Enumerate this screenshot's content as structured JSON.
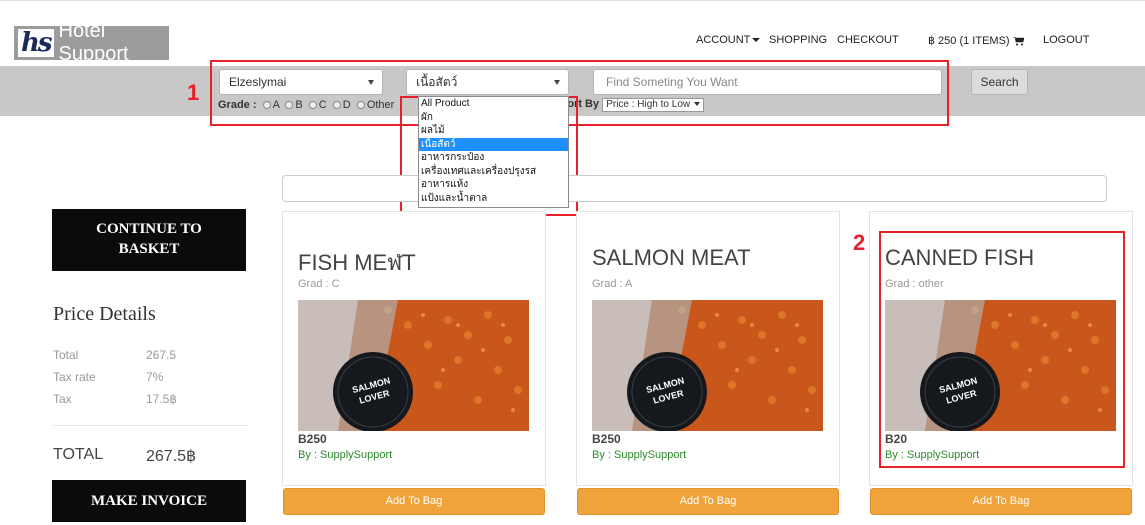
{
  "brand": {
    "mark": "hs",
    "name": "Hotel Support"
  },
  "nav": {
    "account": "ACCOUNT",
    "shopping": "SHOPPING",
    "checkout": "CHECKOUT",
    "cart": "฿ 250 (1 ITEMS)",
    "logout": "LOGOUT"
  },
  "filters": {
    "location": "Elzeslymai",
    "category": "เนื้อสัตว์",
    "search_placeholder": "Find Someting You Want",
    "search_button": "Search",
    "grade_label": "Grade :",
    "grades": [
      "A",
      "B",
      "C",
      "D",
      "Other"
    ],
    "sort_label": "Sort By",
    "sort_value": "Price : High to Low"
  },
  "category_options": [
    "All Product",
    "ผัก",
    "ผลไม้",
    "เนื้อสัตว์",
    "อาหารกระป๋อง",
    "เครื่องเทศและเครื่องปรุงรส",
    "อาหารแห้ง",
    "แป้งและน้ำตาล"
  ],
  "selected_category_index": 3,
  "annotations": {
    "one": "1",
    "two": "2"
  },
  "left_panel": {
    "continue_button_line1": "CONTINUE TO",
    "continue_button_line2": "BASKET",
    "price_title": "Price Details",
    "rows": [
      {
        "label": "Total",
        "value": "267.5"
      },
      {
        "label": "Tax rate",
        "value": "7%"
      },
      {
        "label": "Tax",
        "value": "17.5฿"
      }
    ],
    "total_label": "TOTAL",
    "total_value": "267.5฿",
    "invoice_button": "MAKE INVOICE"
  },
  "products": [
    {
      "title": "FISH MEฬT",
      "grade": "Grad : C",
      "price": "B250",
      "by": "By : SupplySupport",
      "button": "Add To Bag"
    },
    {
      "title": "SALMON MEAT",
      "grade": "Grad : A",
      "price": "B250",
      "by": "By : SupplySupport",
      "button": "Add To Bag"
    },
    {
      "title": "CANNED FISH",
      "grade": "Grad : other",
      "price": "B20",
      "by": "By : SupplySupport",
      "button": "Add To Bag"
    }
  ],
  "image_label": {
    "line1": "SALMON",
    "line2": "LOVER"
  }
}
